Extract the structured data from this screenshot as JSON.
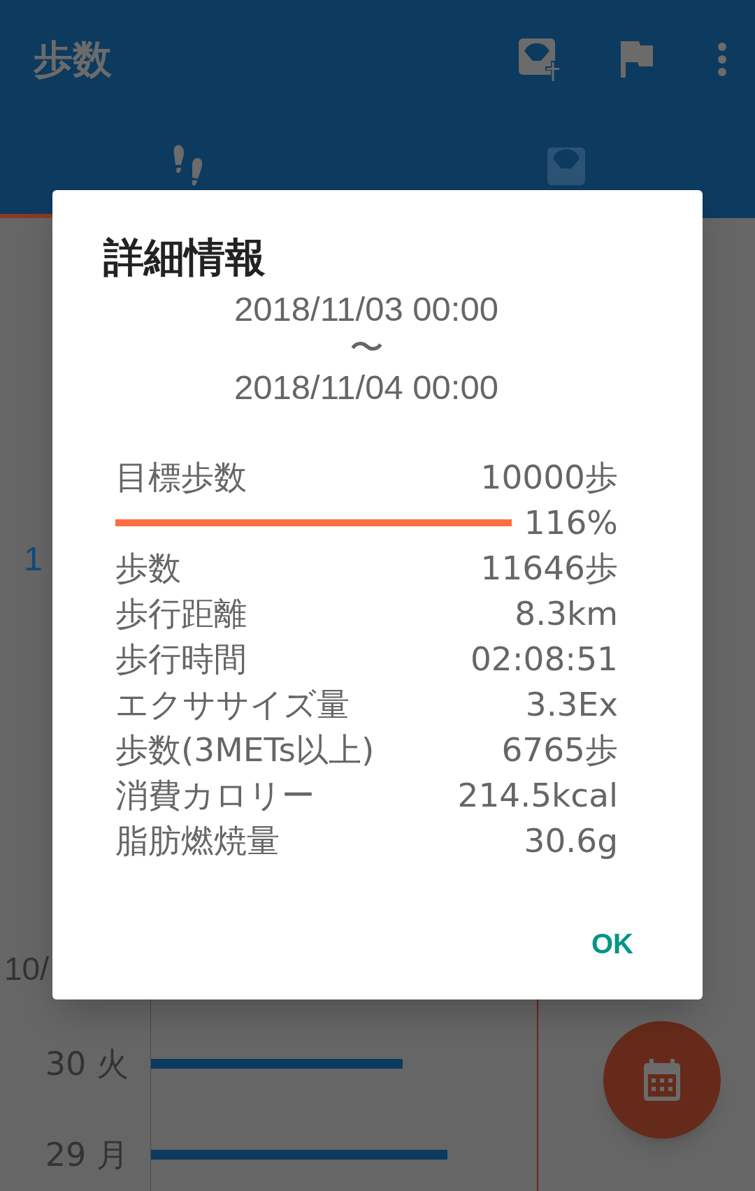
{
  "app_bar": {
    "title": "歩数"
  },
  "tabs": [
    {
      "kind": "steps",
      "selected": true
    },
    {
      "kind": "scale",
      "selected": false
    }
  ],
  "background": {
    "value": "1",
    "date": "10/"
  },
  "chart_rows": [
    {
      "label": "30 火"
    },
    {
      "label": "29 月"
    }
  ],
  "dialog": {
    "title": "詳細情報",
    "start": "2018/11/03 00:00",
    "separator": "〜",
    "end": "2018/11/04 00:00",
    "goal": {
      "label": "目標歩数",
      "value": "10000歩",
      "level": 1,
      "percent": "116%"
    },
    "rows": [
      {
        "label": "歩数",
        "value": "11646歩"
      },
      {
        "label": "歩行距離",
        "value": "8.3km"
      },
      {
        "label": "歩行時間",
        "value": "02:08:51"
      },
      {
        "label": "エクササイズ量",
        "value": "3.3Ex"
      },
      {
        "label": "歩数(3METs以上)",
        "value": "6765歩"
      },
      {
        "label": "消費カロリー",
        "value": "214.5kcal"
      },
      {
        "label": "脂肪燃焼量",
        "value": "30.6g"
      }
    ],
    "ok": "OK"
  }
}
